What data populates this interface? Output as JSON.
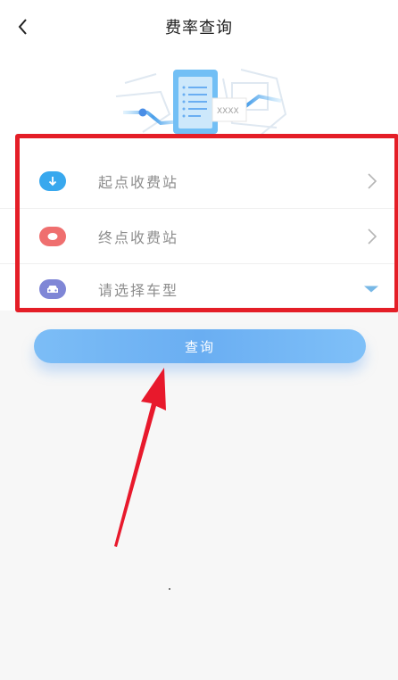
{
  "header": {
    "title": "费率查询",
    "back_icon": "chevron-left-icon"
  },
  "illustration": {
    "card_text": "XXXX"
  },
  "form": {
    "rows": [
      {
        "label": "起点收费站",
        "icon": "download-arrow-icon",
        "icon_color": "#38a8ee",
        "action_icon": "chevron-right-icon"
      },
      {
        "label": "终点收费站",
        "icon": "circle-dot-icon",
        "icon_color": "#ef6f6f",
        "action_icon": "chevron-right-icon"
      },
      {
        "label": "请选择车型",
        "icon": "car-icon",
        "icon_color": "#7f86d6",
        "action_icon": "caret-down-icon"
      }
    ]
  },
  "actions": {
    "query_label": "查询"
  },
  "colors": {
    "highlight": "#e41e27",
    "button": "#6aaef2",
    "annotation_arrow": "#e8192c"
  }
}
